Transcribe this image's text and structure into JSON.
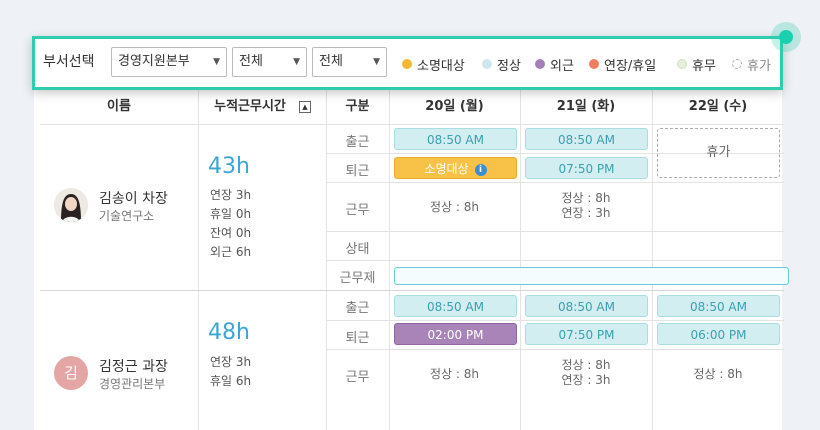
{
  "filter": {
    "title": "부서선택",
    "dept_select": "경영지원본부",
    "select2": "전체",
    "select3": "전체",
    "legend": [
      {
        "label": "소명대상",
        "color": "#f5b731",
        "style": "solid"
      },
      {
        "label": "정상",
        "color": "#cde8ef",
        "style": "solid"
      },
      {
        "label": "외근",
        "color": "#a57fb8",
        "style": "solid"
      },
      {
        "label": "연장/휴일",
        "color": "#ef7f63",
        "style": "solid"
      },
      {
        "label": "휴무",
        "color": "#e6f0dc",
        "style": "solid"
      },
      {
        "label": "휴가",
        "color": "#aaaaaa",
        "style": "dashed"
      }
    ]
  },
  "table": {
    "headers": {
      "name": "이름",
      "total": "누적근무시간",
      "type": "구분",
      "days": [
        "20일 (월)",
        "21일 (화)",
        "22일 (수)"
      ]
    },
    "row_labels": [
      "출근",
      "퇴근",
      "근무",
      "상태",
      "근무제"
    ],
    "employees": [
      {
        "name": "김송이 차장",
        "dept": "기술연구소",
        "total_hours": "43h",
        "stats": [
          "연장 3h",
          "휴일 0h",
          "잔여 0h",
          "외근 6h"
        ],
        "checkin": [
          "08:50 AM",
          "08:50 AM"
        ],
        "checkout": [
          "소명대상",
          "07:50 PM"
        ],
        "work": [
          [
            "정상 : 8h"
          ],
          [
            "정상 : 8h",
            "연장 : 3h"
          ]
        ],
        "day3_status": "휴가"
      },
      {
        "name": "김정근 과장",
        "dept": "경영관리본부",
        "avatar_text": "김",
        "total_hours": "48h",
        "stats": [
          "연장 3h",
          "휴일 6h"
        ],
        "checkin": [
          "08:50 AM",
          "08:50 AM",
          "08:50 AM"
        ],
        "checkout": [
          "02:00 PM",
          "07:50 PM",
          "06:00 PM"
        ],
        "work": [
          [
            "정상 : 8h"
          ],
          [
            "정상 : 8h",
            "연장 : 3h"
          ],
          [
            "정상 : 8h"
          ]
        ]
      }
    ]
  }
}
